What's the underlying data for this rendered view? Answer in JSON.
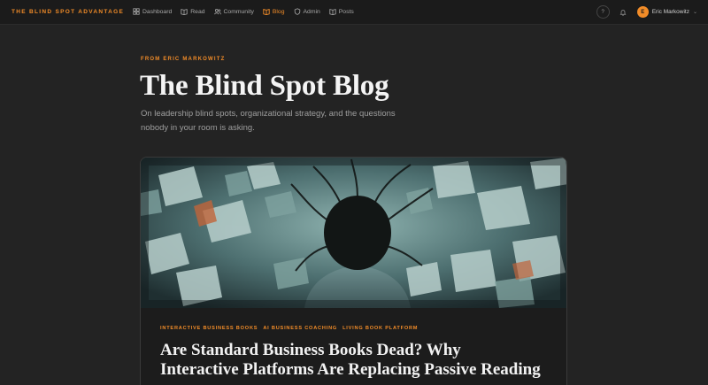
{
  "brand": "THE BLIND SPOT ADVANTAGE",
  "nav": [
    {
      "label": "Dashboard",
      "icon": "dashboard-icon"
    },
    {
      "label": "Read",
      "icon": "book-icon"
    },
    {
      "label": "Community",
      "icon": "users-icon"
    },
    {
      "label": "Blog",
      "icon": "book-open-icon",
      "active": true
    },
    {
      "label": "Admin",
      "icon": "shield-icon"
    },
    {
      "label": "Posts",
      "icon": "book-icon"
    }
  ],
  "header_tools": {
    "help": "?",
    "user_initial": "E",
    "user_name": "Eric Markowitz"
  },
  "page": {
    "eyebrow": "FROM ERIC MARKOWITZ",
    "title": "The Blind Spot Blog",
    "subtitle": "On leadership blind spots, organizational strategy, and the questions nobody in your room is asking."
  },
  "featured_post": {
    "tags": [
      "INTERACTIVE BUSINESS BOOKS",
      "AI BUSINESS COACHING",
      "LIVING BOOK PLATFORM"
    ],
    "title": "Are Standard Business Books Dead? Why Interactive Platforms Are Replacing Passive Reading"
  },
  "colors": {
    "accent": "#f28c28",
    "background": "#232323",
    "nav_bg": "#1b1b1b"
  }
}
